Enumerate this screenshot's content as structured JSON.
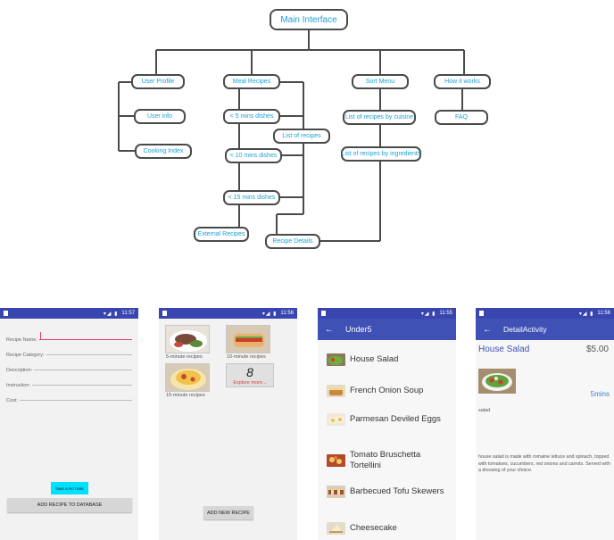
{
  "diagram": {
    "main": "Main Interface",
    "user_profile": "User Profile",
    "meal_recipes": "Meal Recipes",
    "sort_menu": "Sort Menu",
    "how_it_works": "How it works",
    "user_info": "User info",
    "cooking_index": "Cooking Index",
    "under5": "< 5 mins dishes",
    "list_of_recipes": "List of recipes",
    "under10": "< 10 mins dishes",
    "under15": "< 15 mins dishes",
    "external_recipes": "External Recipes",
    "recipe_details": "Recipe Details",
    "list_by_cuisine": "List of recipes by cuisine",
    "list_by_ingredients": "List of recipes by ingredients",
    "faq": "FAQ"
  },
  "phone1": {
    "time": "11:57",
    "fields": [
      "Recipe Name:",
      "Recipe Category:",
      "Description:",
      "Instruction:",
      "Cost:"
    ],
    "take_picture": "TAKE A PICTURE",
    "add_button": "ADD RECIPE TO DATABASE"
  },
  "phone2": {
    "time": "11:56",
    "five_min": "5-minute recipes",
    "ten_min": "10-minute recipes",
    "fifteen_min": "15-minute recipes",
    "explore_digit": "8",
    "explore": "Explore more...",
    "add_new": "ADD NEW RECIPE"
  },
  "phone3": {
    "time": "11:55",
    "title": "Under5",
    "items": [
      "House Salad",
      "French Onion Soup",
      "Parmesan Deviled Eggs",
      "Tomato Bruschetta Tortellini",
      "Barbecued Tofu Skewers",
      "Cheesecake"
    ]
  },
  "phone4": {
    "time": "11:56",
    "title": "DetailActivity",
    "name": "House Salad",
    "price": "$5.00",
    "time_needed": "5mins",
    "category": "salad",
    "description": "house salad is made with romaine lettuce and spinach, topped with tomatoes, cucumbers, red onions and carrots. Served with a dressing of your choice."
  },
  "colors": {
    "statusbar": "#3a46b0",
    "appbar": "#3f51b5",
    "link": "#1c9fd6",
    "accent_pink": "#e23b6b",
    "cyan_button": "#00e0ff"
  }
}
